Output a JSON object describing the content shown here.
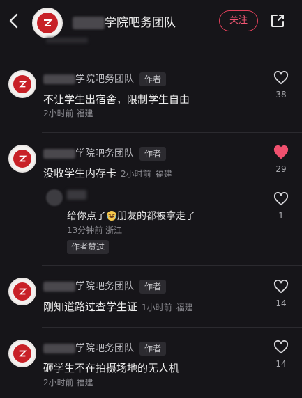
{
  "header": {
    "title_suffix": "学院吧务团队",
    "follow_label": "关注",
    "icons": {
      "back": "back-arrow-icon",
      "share": "share-icon"
    }
  },
  "comments": [
    {
      "name_suffix": "学院吧务团队",
      "author_tag": "作者",
      "text": "不让学生出宿舍，限制学生自由",
      "time": "2小时前",
      "location": "福建",
      "likes": "38",
      "liked": false
    },
    {
      "name_suffix": "学院吧务团队",
      "author_tag": "作者",
      "text": "没收学生内存卡",
      "time": "2小时前",
      "location": "福建",
      "likes": "29",
      "liked": true,
      "reply": {
        "text_before": "给你点了",
        "text_after": "朋友的都被拿走了",
        "time": "13分钟前",
        "location": "浙江",
        "likes": "1",
        "author_liked": "作者赞过"
      }
    },
    {
      "name_suffix": "学院吧务团队",
      "author_tag": "作者",
      "text": "刚知道路过查学生证",
      "time": "1小时前",
      "location": "福建",
      "likes": "14",
      "liked": false
    },
    {
      "name_suffix": "学院吧务团队",
      "author_tag": "作者",
      "text": "砸学生不在拍摄场地的无人机",
      "time": "2小时前",
      "location": "福建",
      "likes": "14",
      "liked": false
    }
  ],
  "colors": {
    "background": "#161519",
    "accent": "#f25773",
    "liked_heart": "#f0506e",
    "logo_red": "#c82127"
  }
}
